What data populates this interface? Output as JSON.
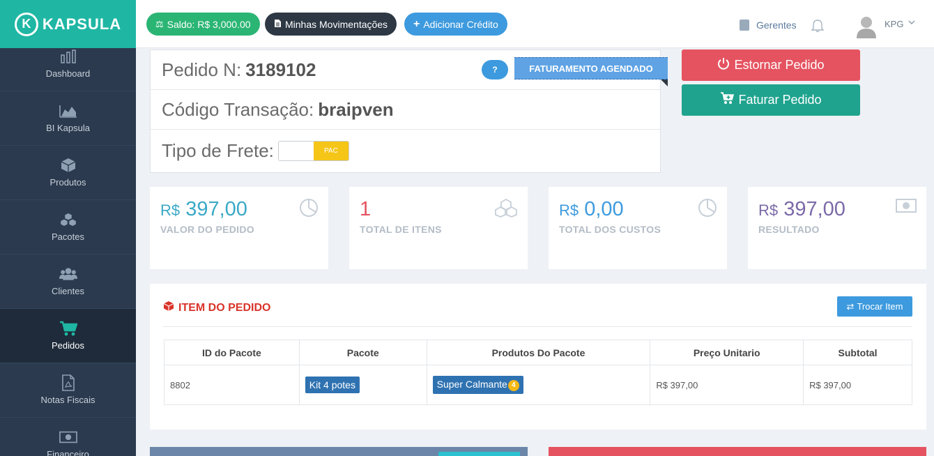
{
  "brand": {
    "name": "KAPSULA",
    "mark": "K"
  },
  "sidebar": {
    "items": [
      {
        "label": "Dashboard",
        "icon": "bar-chart-icon"
      },
      {
        "label": "BI Kapsula",
        "icon": "area-chart-icon"
      },
      {
        "label": "Produtos",
        "icon": "cube-icon"
      },
      {
        "label": "Pacotes",
        "icon": "cubes-icon"
      },
      {
        "label": "Clientes",
        "icon": "users-icon"
      },
      {
        "label": "Pedidos",
        "icon": "cart-icon",
        "active": true
      },
      {
        "label": "Notas Fiscais",
        "icon": "pdf-icon"
      },
      {
        "label": "Financeiro",
        "icon": "money-icon"
      }
    ]
  },
  "topbar": {
    "saldo": "Saldo: R$ 3,000.00",
    "movimentacoes": "Minhas Movimentações",
    "adicionar_credito": "Adicionar Crédito",
    "gerentes": "Gerentes",
    "user": "KPG"
  },
  "order": {
    "pedido_label": "Pedido N:",
    "pedido_num": "3189102",
    "help": "?",
    "status": "FATURAMENTO AGENDADO",
    "transacao_label": "Código Transação:",
    "transacao_code": "braipven",
    "frete_label": "Tipo de Frete:",
    "frete_value": "PAC"
  },
  "actions": {
    "estornar": "Estornar Pedido",
    "faturar": "Faturar Pedido"
  },
  "stats": [
    {
      "currency": "R$",
      "value": "397,00",
      "label": "VALOR DO PEDIDO",
      "color": "#3aa9c6",
      "icon": "pie-chart-icon"
    },
    {
      "currency": "",
      "value": "1",
      "label": "TOTAL DE ITENS",
      "color": "#e55360",
      "icon": "cubes-icon"
    },
    {
      "currency": "R$",
      "value": "0,00",
      "label": "TOTAL DOS CUSTOS",
      "color": "#3d9ade",
      "icon": "pie-chart-icon"
    },
    {
      "currency": "R$",
      "value": "397,00",
      "label": "RESULTADO",
      "color": "#7b6aa8",
      "icon": "money-icon"
    }
  ],
  "items": {
    "title": "ITEM DO PEDIDO",
    "trocar": "Trocar Item",
    "columns": [
      "ID do Pacote",
      "Pacote",
      "Produtos Do Pacote",
      "Preço Unitario",
      "Subtotal"
    ],
    "rows": [
      {
        "id": "8802",
        "pacote": "Kit 4 potes",
        "produto": "Super Calmante",
        "qty": "4",
        "preco": "R$ 397,00",
        "subtotal": "R$ 397,00"
      }
    ]
  }
}
